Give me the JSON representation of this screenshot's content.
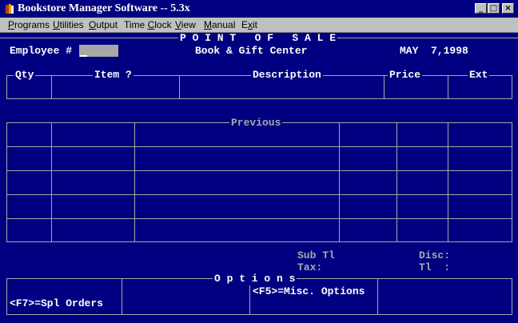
{
  "window": {
    "title": "Bookstore Manager Software -- 5.3x",
    "controls": {
      "minimize": "_",
      "maximize": "□",
      "close": "×"
    }
  },
  "menu": [
    {
      "label": "Programs",
      "accel": "P"
    },
    {
      "label": "Utilities",
      "accel": "U"
    },
    {
      "label": "Output",
      "accel": "O"
    },
    {
      "label": "Time Clock",
      "accel": "C"
    },
    {
      "label": "View",
      "accel": "V"
    },
    {
      "label": "Manual",
      "accel": "M"
    },
    {
      "label": "Exit",
      "accel": "x"
    }
  ],
  "pos": {
    "title": "P O I N T   O F   S A L E",
    "employee_label": "Employee #",
    "employee_value": "",
    "store_name": "Book & Gift Center",
    "date": "MAY  7,1998",
    "columns": {
      "qty": "Qty",
      "item": "Item ?",
      "description": "Description",
      "price": "Price",
      "ext": "Ext"
    },
    "previous_label": "Previous",
    "totals": {
      "subtotal": "Sub Tl",
      "tax": "Tax:",
      "disc": "Disc:",
      "total": "Tl  :"
    },
    "options_title": "O p t i o n s",
    "options": [
      {
        "key": "<F7>=Spl Orders"
      },
      {
        "key": ""
      },
      {
        "key": "<F5>=Misc. Options"
      },
      {
        "key": ""
      }
    ]
  },
  "colors": {
    "screen_bg": "#000080",
    "fg": "#ffffff",
    "line": "#a8a8a8",
    "chrome": "#c0c0c0"
  }
}
